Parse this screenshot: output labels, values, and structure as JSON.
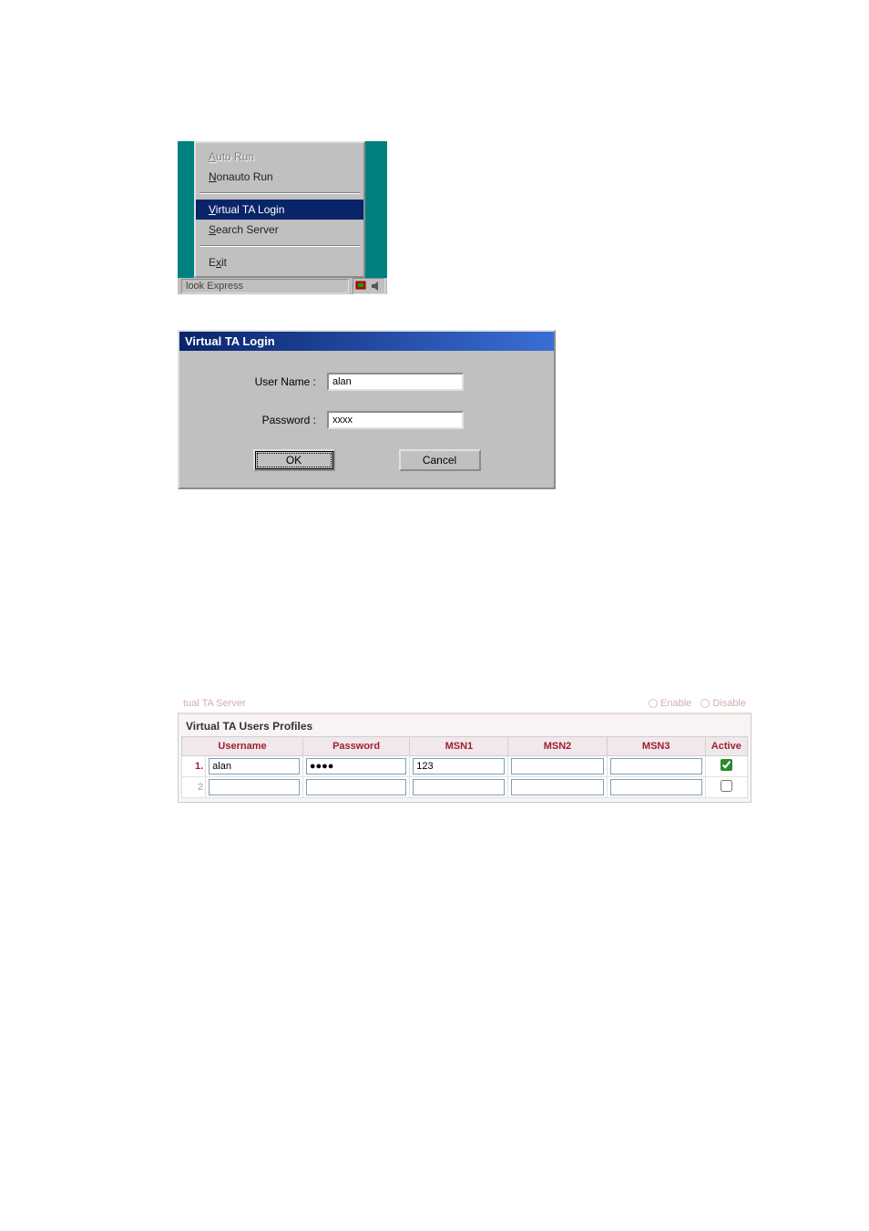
{
  "menu": {
    "auto_run": "Auto Run",
    "nonauto_run": "Nonauto Run",
    "virtual_ta_login": "Virtual TA Login",
    "search_server": "Search Server",
    "exit": "Exit",
    "taskbar_button": "look Express"
  },
  "dialog": {
    "title": "Virtual TA Login",
    "username_label": "User Name :",
    "username_value": "alan",
    "password_label": "Password :",
    "password_value": "xxxx",
    "ok": "OK",
    "cancel": "Cancel"
  },
  "server_toggle": {
    "label": "tual TA Server",
    "enable": "Enable",
    "disable": "Disable"
  },
  "profiles": {
    "title": "Virtual TA Users Profiles",
    "headers": {
      "username": "Username",
      "password": "Password",
      "msn1": "MSN1",
      "msn2": "MSN2",
      "msn3": "MSN3",
      "active": "Active"
    },
    "rows": [
      {
        "num": "1.",
        "username": "alan",
        "password": "●●●●",
        "msn1": "123",
        "msn2": "",
        "msn3": "",
        "active": true
      },
      {
        "num": "2",
        "username": "",
        "password": "",
        "msn1": "",
        "msn2": "",
        "msn3": "",
        "active": false
      }
    ]
  }
}
